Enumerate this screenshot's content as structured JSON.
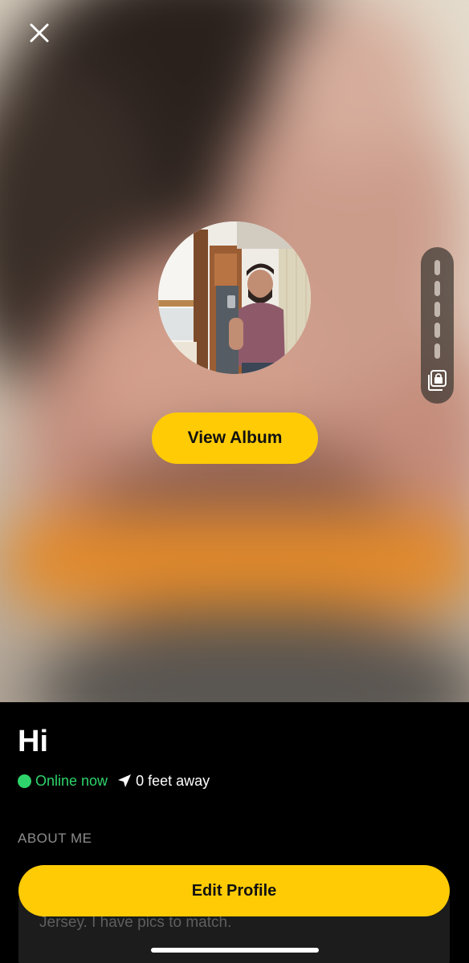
{
  "header": {
    "close_icon": "close-icon"
  },
  "album": {
    "view_album_label": "View Album",
    "thumbnail_icon": "album-photo",
    "side_scrubber": {
      "steps": 6,
      "lock_icon": "locked-album-icon"
    }
  },
  "profile": {
    "name": "Hi",
    "status": "Online now",
    "status_color": "#2ed46b",
    "location_icon": "location-arrow-icon",
    "distance": "0 feet away",
    "about_header": "ABOUT ME",
    "about_text_partial": "Jersey. I have pics to match."
  },
  "actions": {
    "edit_profile_label": "Edit Profile"
  },
  "colors": {
    "accent": "#ffcb05",
    "background": "#000000",
    "online": "#2ed46b"
  }
}
